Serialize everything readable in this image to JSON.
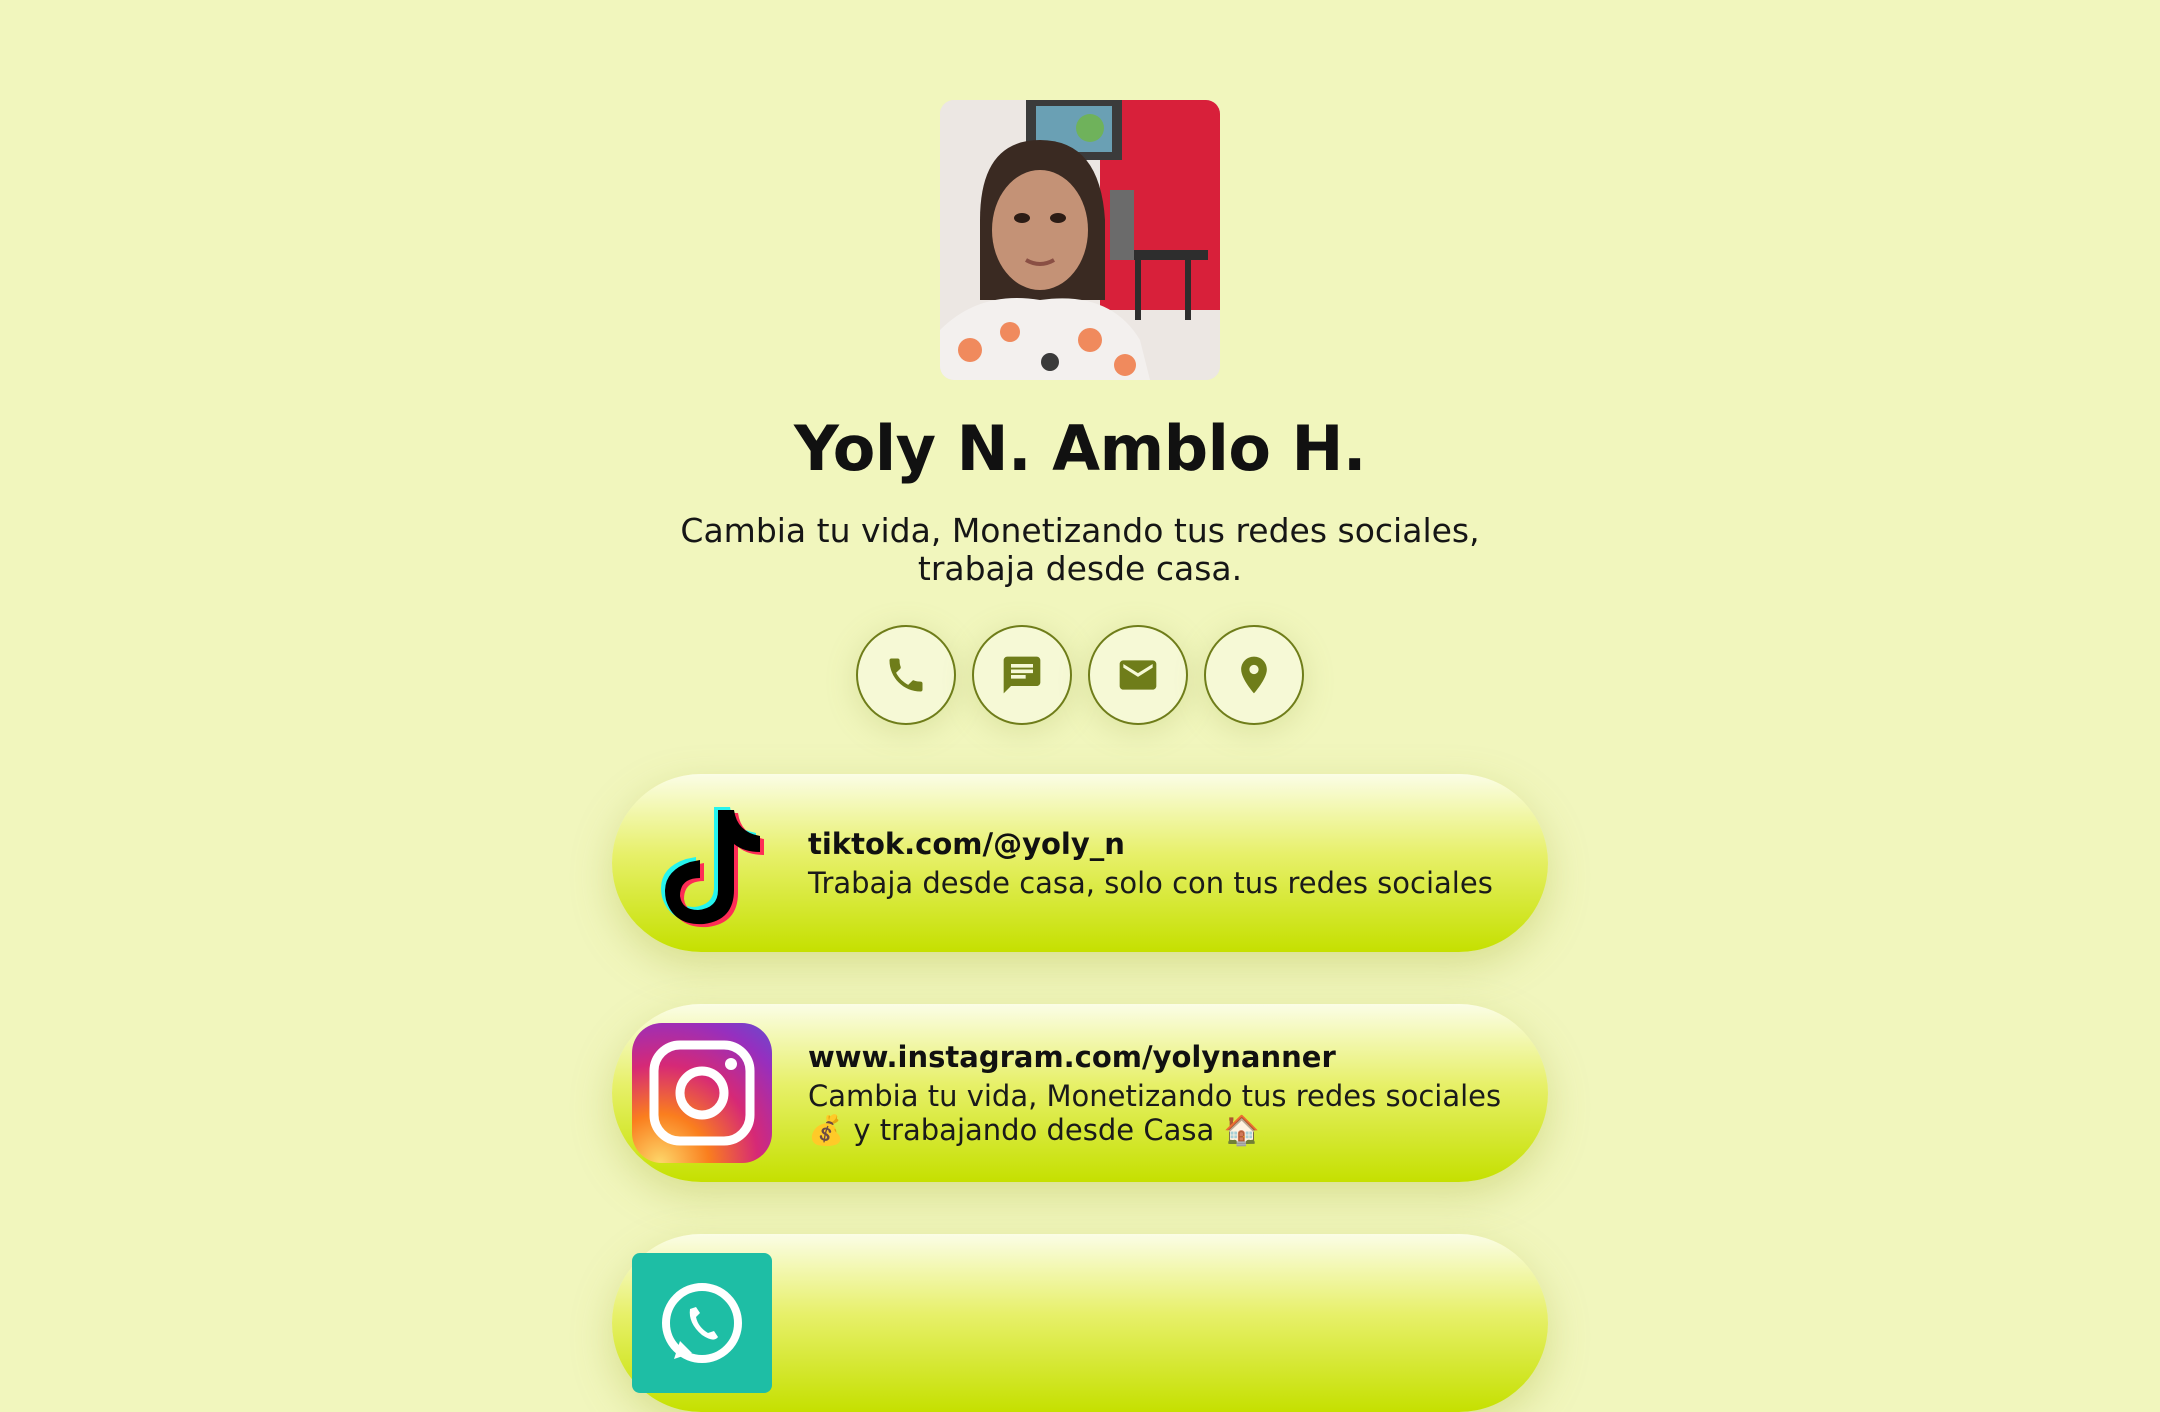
{
  "profile": {
    "name": "Yoly N. Amblo H.",
    "bio": "Cambia tu vida, Monetizando tus redes sociales, trabaja desde casa."
  },
  "contacts": [
    {
      "icon": "phone-icon"
    },
    {
      "icon": "message-icon"
    },
    {
      "icon": "email-icon"
    },
    {
      "icon": "location-icon"
    }
  ],
  "links": [
    {
      "icon": "tiktok-icon",
      "title": "tiktok.com/@yoly_n",
      "desc": "Trabaja desde casa, solo con tus redes sociales"
    },
    {
      "icon": "instagram-icon",
      "title": "www.instagram.com/yolynanner",
      "desc": "Cambia tu vida, Monetizando tus redes sociales 💰 y trabajando desde Casa 🏠"
    },
    {
      "icon": "whatsapp-icon",
      "title": "",
      "desc": ""
    }
  ],
  "colors": {
    "background": "#f1f6bd",
    "accent": "#6f7d1a",
    "card_bottom": "#c5e000"
  }
}
